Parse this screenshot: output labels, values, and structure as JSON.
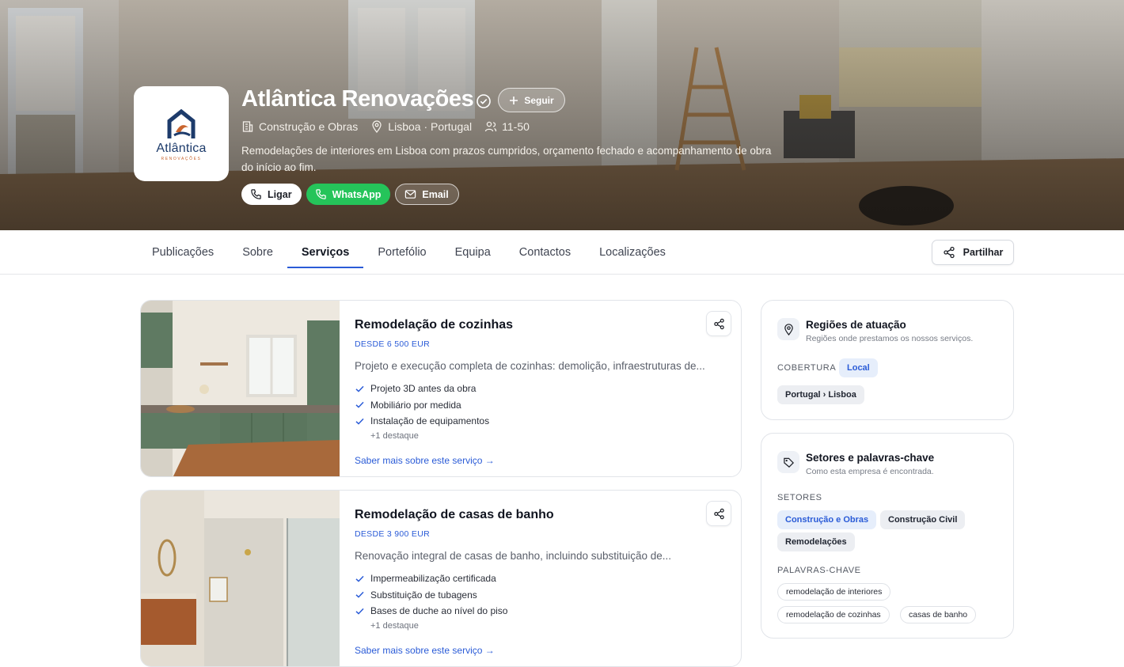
{
  "company": {
    "name": "Atlântica Renovações",
    "logo_word": "Atlântica",
    "logo_sub": "RENOVAÇÕES",
    "follow_label": "Seguir",
    "sector": "Construção e Obras",
    "location": "Lisboa · Portugal",
    "size": "11-50",
    "description": "Remodelações de interiores em Lisboa com prazos cumpridos, orçamento fechado e acompanhamento de obra do início ao fim.",
    "cta": {
      "call": "Ligar",
      "whatsapp": "WhatsApp",
      "email": "Email"
    }
  },
  "colors": {
    "accent": "#2a5bd7",
    "whatsapp": "#25c45a",
    "logo_navy": "#1d3b6b",
    "logo_orange": "#c9652f"
  },
  "tabs": [
    {
      "label": "Publicações"
    },
    {
      "label": "Sobre"
    },
    {
      "label": "Serviços",
      "active": true
    },
    {
      "label": "Portefólio"
    },
    {
      "label": "Equipa"
    },
    {
      "label": "Contactos"
    },
    {
      "label": "Localizações"
    }
  ],
  "share_label": "Partilhar",
  "services": [
    {
      "title": "Remodelação de cozinhas",
      "price": "DESDE 6 500 EUR",
      "description": "Projeto e execução completa de cozinhas: demolição, infraestruturas de...",
      "features": [
        "Projeto 3D antes da obra",
        "Mobiliário por medida",
        "Instalação de equipamentos"
      ],
      "more": "+1 destaque",
      "link": "Saber mais sobre este serviço →"
    },
    {
      "title": "Remodelação de casas de banho",
      "price": "DESDE 3 900 EUR",
      "description": "Renovação integral de casas de banho, incluindo substituição de...",
      "features": [
        "Impermeabilização certificada",
        "Substituição de tubagens",
        "Bases de duche ao nível do piso"
      ],
      "more": "+1 destaque",
      "link": "Saber mais sobre este serviço →"
    }
  ],
  "regions": {
    "title": "Regiões de atuação",
    "subtitle": "Regiões onde prestamos os nossos serviços.",
    "coverage_label": "COBERTURA",
    "coverage_value": "Local",
    "region": "Portugal › Lisboa"
  },
  "sectors": {
    "title": "Setores e palavras-chave",
    "subtitle": "Como esta empresa é encontrada.",
    "sectors_label": "SETORES",
    "sectors": [
      "Construção e Obras",
      "Construção Civil",
      "Remodelações"
    ],
    "keywords_label": "PALAVRAS-CHAVE",
    "keywords": [
      "remodelação de interiores",
      "remodelação de cozinhas",
      "casas de banho"
    ]
  }
}
